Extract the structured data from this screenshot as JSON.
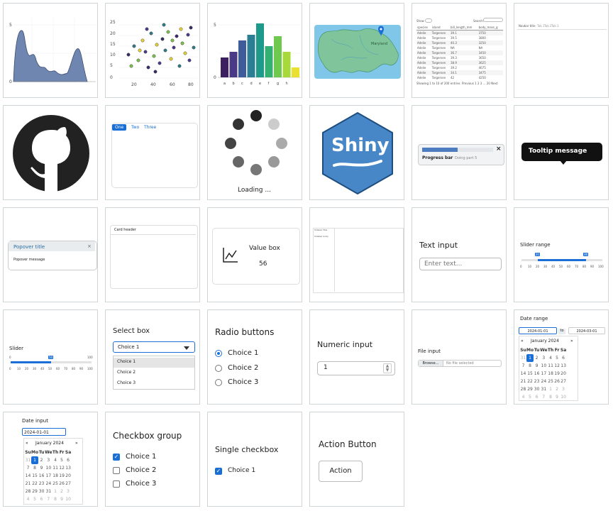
{
  "colors": {
    "accent": "#1a6fd6",
    "tile_border": "#cfd4d8",
    "area_fill": "#6f86b0",
    "map_water": "#7fc6e8",
    "map_land": "#7fc49a",
    "shiny_hex": "#4787c8"
  },
  "tiles": {
    "density": {
      "y_labels": [
        "5",
        "0"
      ]
    },
    "scatter": {
      "y_labels": [
        "25",
        "20",
        "15",
        "10",
        "5",
        "0"
      ],
      "x_labels": [
        "20",
        "40",
        "60",
        "80"
      ]
    },
    "bars": {
      "y_labels": [
        "5",
        "0"
      ],
      "x_labels": [
        "a",
        "b",
        "c",
        "d",
        "e",
        "f",
        "g",
        "h"
      ]
    },
    "map": {
      "label": "Maryland"
    },
    "table": {
      "header_left": "Show",
      "header_right": "Search:",
      "footer": "Showing 1 to 10 of 200 entries",
      "footer_right": "Previous 1 2 3 ... 20 Next",
      "columns": [
        "species",
        "island",
        "bill_length_mm",
        "body_mass_g"
      ],
      "rows": [
        [
          "Adelie",
          "Torgersen",
          "39.1",
          "3750"
        ],
        [
          "Adelie",
          "Torgersen",
          "39.5",
          "3800"
        ],
        [
          "Adelie",
          "Torgersen",
          "40.3",
          "3250"
        ],
        [
          "Adelie",
          "Torgersen",
          "NA",
          "NA"
        ],
        [
          "Adelie",
          "Torgersen",
          "36.7",
          "3450"
        ],
        [
          "Adelie",
          "Torgersen",
          "39.3",
          "3650"
        ],
        [
          "Adelie",
          "Torgersen",
          "38.9",
          "3625"
        ],
        [
          "Adelie",
          "Torgersen",
          "39.2",
          "4675"
        ],
        [
          "Adelie",
          "Torgersen",
          "34.1",
          "3475"
        ],
        [
          "Adelie",
          "Torgersen",
          "42",
          "4250"
        ]
      ]
    },
    "navbar": {
      "title": "Navbar title",
      "links": [
        "Tab 1",
        "Tab 2",
        "Tab 3"
      ]
    },
    "github": {},
    "tabs": {
      "items": [
        "One",
        "Two",
        "Three"
      ]
    },
    "loading": {
      "label": "Loading ..."
    },
    "shiny": {
      "label": "Shiny"
    },
    "progress": {
      "title": "Progress bar",
      "detail": "Doing part 5",
      "value": 0.5
    },
    "tooltip": {
      "label": "Tooltip message"
    },
    "popover": {
      "title": "Popover title",
      "message": "Popover message",
      "close": "×"
    },
    "card": {
      "header": "Card header"
    },
    "valuebox": {
      "title": "Value box",
      "value": "56"
    },
    "sidebar": {
      "title": "Sidebar title",
      "item": "Sidebar body"
    },
    "textinput": {
      "label": "Text input",
      "placeholder": "Enter text..."
    },
    "sliderrange": {
      "label": "Slider range",
      "min_label": "20",
      "max_label": "80",
      "ticks": [
        "0",
        "10",
        "20",
        "30",
        "40",
        "50",
        "60",
        "70",
        "80",
        "90",
        "100"
      ],
      "low": 0.2,
      "high": 0.8
    },
    "slider": {
      "label": "Slider",
      "value_label": "50",
      "min_label": "0",
      "max_label": "100",
      "ticks": [
        "0",
        "10",
        "20",
        "30",
        "40",
        "50",
        "60",
        "70",
        "80",
        "90",
        "100"
      ],
      "value": 0.5
    },
    "selectbox": {
      "label": "Select box",
      "selected": "Choice 1",
      "options": [
        "Choice 1",
        "Choice 2",
        "Choice 3"
      ]
    },
    "radio": {
      "label": "Radio buttons",
      "options": [
        "Choice 1",
        "Choice 2",
        "Choice 3"
      ],
      "selected_index": 0
    },
    "numeric": {
      "label": "Numeric input",
      "value": "1"
    },
    "fileinput": {
      "label": "File input",
      "button": "Browse...",
      "status": "No file selected"
    },
    "daterange": {
      "label": "Date range",
      "start": "2024-01-01",
      "sep": "to",
      "end": "2024-03-01",
      "month": "January 2024",
      "weekdays": [
        "Su",
        "Mo",
        "Tu",
        "We",
        "Th",
        "Fr",
        "Sa"
      ],
      "weeks": [
        [
          "31",
          "1",
          "2",
          "3",
          "4",
          "5",
          "6"
        ],
        [
          "7",
          "8",
          "9",
          "10",
          "11",
          "12",
          "13"
        ],
        [
          "14",
          "15",
          "16",
          "17",
          "18",
          "19",
          "20"
        ],
        [
          "21",
          "22",
          "23",
          "24",
          "25",
          "26",
          "27"
        ],
        [
          "28",
          "29",
          "30",
          "31",
          "1",
          "2",
          "3"
        ],
        [
          "4",
          "5",
          "6",
          "7",
          "8",
          "9",
          "10"
        ]
      ]
    },
    "dateinput": {
      "label": "Date input",
      "value": "2024-01-01",
      "month": "January 2024",
      "weekdays": [
        "Su",
        "Mo",
        "Tu",
        "We",
        "Th",
        "Fr",
        "Sa"
      ],
      "weeks": [
        [
          "31",
          "1",
          "2",
          "3",
          "4",
          "5",
          "6"
        ],
        [
          "7",
          "8",
          "9",
          "10",
          "11",
          "12",
          "13"
        ],
        [
          "14",
          "15",
          "16",
          "17",
          "18",
          "19",
          "20"
        ],
        [
          "21",
          "22",
          "23",
          "24",
          "25",
          "26",
          "27"
        ],
        [
          "28",
          "29",
          "30",
          "31",
          "1",
          "2",
          "3"
        ],
        [
          "4",
          "5",
          "6",
          "7",
          "8",
          "9",
          "10"
        ]
      ]
    },
    "checkboxgroup": {
      "label": "Checkbox group",
      "options": [
        "Choice 1",
        "Choice 2",
        "Choice 3"
      ],
      "checked": [
        true,
        false,
        false
      ]
    },
    "singlecheckbox": {
      "label": "Single checkbox",
      "option": "Choice 1",
      "checked": true
    },
    "actionbutton": {
      "label": "Action Button",
      "button": "Action"
    }
  }
}
